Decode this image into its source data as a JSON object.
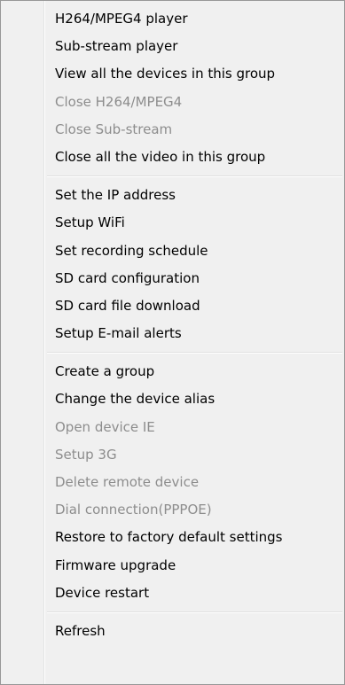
{
  "menu": {
    "group1": [
      {
        "label": "H264/MPEG4 player",
        "enabled": true
      },
      {
        "label": "Sub-stream player",
        "enabled": true
      },
      {
        "label": "View all the devices in this group",
        "enabled": true
      },
      {
        "label": "Close H264/MPEG4",
        "enabled": false
      },
      {
        "label": "Close Sub-stream",
        "enabled": false
      },
      {
        "label": "Close all the video in this group",
        "enabled": true
      }
    ],
    "group2": [
      {
        "label": "Set the IP address",
        "enabled": true
      },
      {
        "label": "Setup WiFi",
        "enabled": true
      },
      {
        "label": "Set recording schedule",
        "enabled": true
      },
      {
        "label": "SD card configuration",
        "enabled": true
      },
      {
        "label": "SD card file download",
        "enabled": true
      },
      {
        "label": "Setup E-mail alerts",
        "enabled": true
      }
    ],
    "group3": [
      {
        "label": "Create a group",
        "enabled": true
      },
      {
        "label": "Change the device alias",
        "enabled": true
      },
      {
        "label": "Open device IE",
        "enabled": false
      },
      {
        "label": "Setup 3G",
        "enabled": false
      },
      {
        "label": "Delete remote device",
        "enabled": false
      },
      {
        "label": "Dial connection(PPPOE)",
        "enabled": false
      },
      {
        "label": "Restore to factory default settings",
        "enabled": true
      },
      {
        "label": "Firmware upgrade",
        "enabled": true
      },
      {
        "label": "Device restart",
        "enabled": true
      }
    ],
    "group4": [
      {
        "label": "Refresh",
        "enabled": true
      }
    ]
  },
  "colors": {
    "background": "#f0f0f0",
    "text_enabled": "#000000",
    "text_disabled": "#8d8d8d"
  }
}
